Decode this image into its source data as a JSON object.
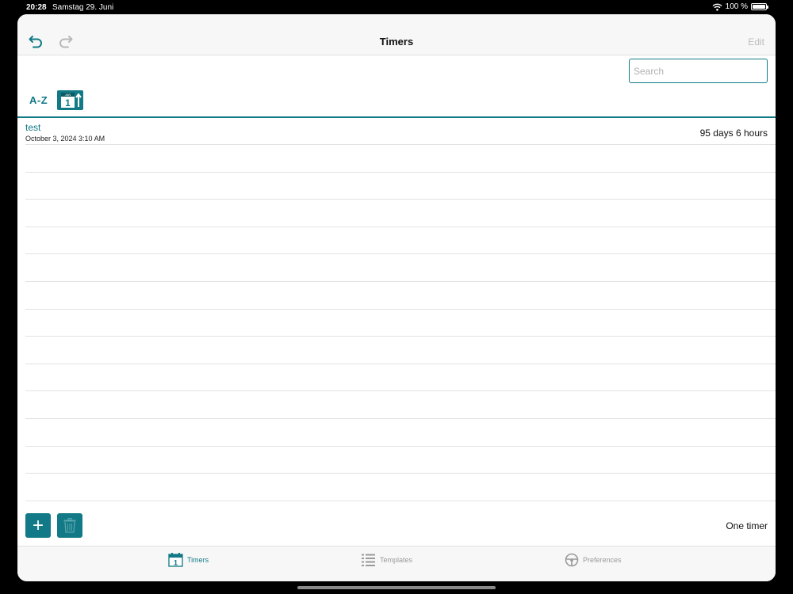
{
  "status_bar": {
    "time": "20:28",
    "date": "Samstag 29. Juni",
    "battery": "100 %"
  },
  "navbar": {
    "title": "Timers",
    "edit_label": "Edit"
  },
  "search": {
    "placeholder": "Search"
  },
  "sort": {
    "alpha_label": "A-Z",
    "date_icon_month": "JAN",
    "date_icon_day": "1"
  },
  "timers": [
    {
      "name": "test",
      "date": "October 3, 2024 3:10 AM",
      "duration": "95 days 6 hours"
    },
    {
      "name": "",
      "date": "",
      "duration": ""
    },
    {
      "name": "",
      "date": "",
      "duration": ""
    },
    {
      "name": "",
      "date": "",
      "duration": ""
    },
    {
      "name": "",
      "date": "",
      "duration": ""
    },
    {
      "name": "",
      "date": "",
      "duration": ""
    },
    {
      "name": "",
      "date": "",
      "duration": ""
    },
    {
      "name": "",
      "date": "",
      "duration": ""
    },
    {
      "name": "",
      "date": "",
      "duration": ""
    },
    {
      "name": "",
      "date": "",
      "duration": ""
    },
    {
      "name": "",
      "date": "",
      "duration": ""
    },
    {
      "name": "",
      "date": "",
      "duration": ""
    },
    {
      "name": "",
      "date": "",
      "duration": ""
    },
    {
      "name": "",
      "date": "",
      "duration": ""
    }
  ],
  "footer": {
    "add_label": "+",
    "count_label": "One timer"
  },
  "tabbar": {
    "timers": {
      "label": "Timers",
      "icon_day": "1"
    },
    "templates": {
      "label": "Templates"
    },
    "preferences": {
      "label": "Preferences"
    }
  },
  "colors": {
    "accent": "#117a86",
    "disabled": "#bdbdbd"
  },
  "icons": [
    "wifi-icon",
    "battery-icon",
    "undo-icon",
    "redo-icon",
    "calendar-sort-icon",
    "trash-icon",
    "calendar-icon",
    "list-icon",
    "steering-wheel-icon"
  ]
}
